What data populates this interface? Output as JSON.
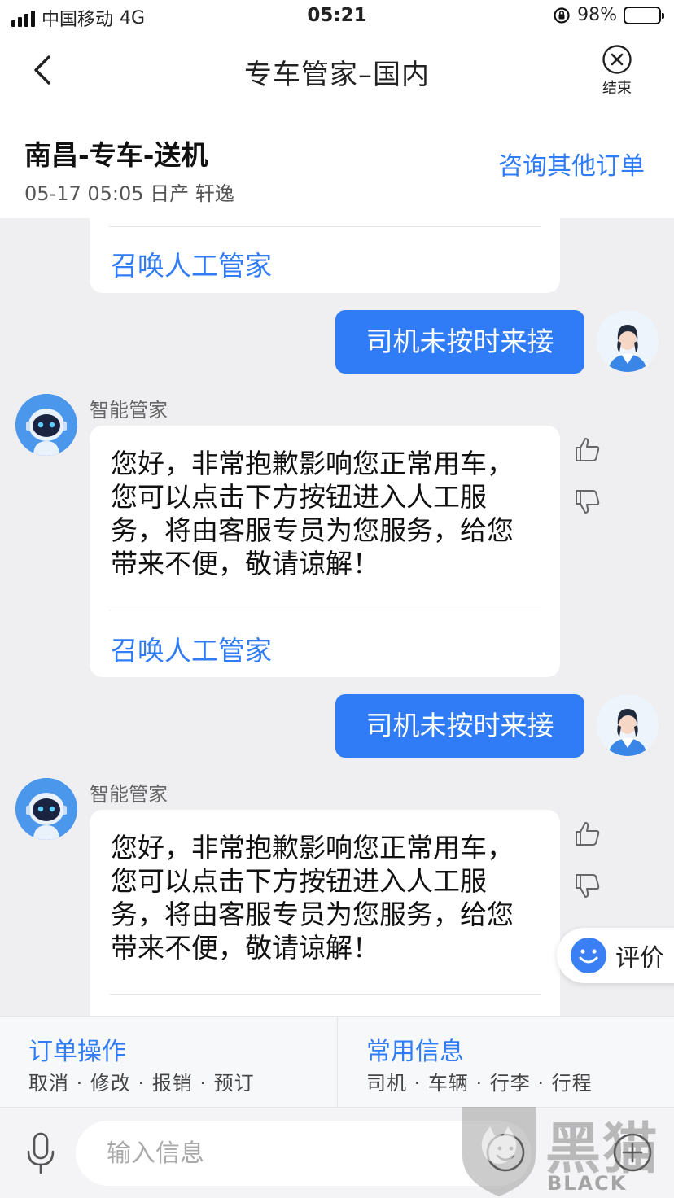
{
  "status_bar": {
    "carrier": "中国移动",
    "network": "4G",
    "time": "05:21",
    "battery_percent": "98%",
    "battery_level": 0.98
  },
  "nav": {
    "title": "专车管家–国内",
    "end_label": "结束"
  },
  "order": {
    "title": "南昌-专车-送机",
    "subtitle": "05-17 05:05  日产 轩逸",
    "other_orders_label": "咨询其他订单"
  },
  "chat": {
    "bot_name": "智能管家",
    "call_human_label": "召唤人工管家",
    "messages": [
      {
        "sender": "user",
        "text": "司机未按时来接"
      },
      {
        "sender": "bot",
        "text": "您好，非常抱歉影响您正常用车，您可以点击下方按钮进入人工服务，将由客服专员为您服务，给您带来不便，敬请谅解！"
      },
      {
        "sender": "user",
        "text": "司机未按时来接"
      },
      {
        "sender": "bot",
        "text": "您好，非常抱歉影响您正常用车，您可以点击下方按钮进入人工服务，将由客服专员为您服务，给您带来不便，敬请谅解！"
      }
    ]
  },
  "rate_button": {
    "label": "评价"
  },
  "quick_panel": {
    "order_ops": {
      "title": "订单操作",
      "items": "取消 · 修改 · 报销 · 预订"
    },
    "common_info": {
      "title": "常用信息",
      "items": "司机 · 车辆 · 行李 · 行程"
    }
  },
  "input": {
    "placeholder": "输入信息"
  },
  "watermark": {
    "cn": "黑猫",
    "en": "BLACK CAT"
  },
  "colors": {
    "accent": "#2f7cf6",
    "background": "#efeff1"
  },
  "icons": [
    "back-icon",
    "close-circle-icon",
    "thumbs-up-icon",
    "thumbs-down-icon",
    "smile-icon",
    "mic-icon",
    "emoji-icon",
    "plus-icon",
    "robot-avatar",
    "user-avatar"
  ]
}
